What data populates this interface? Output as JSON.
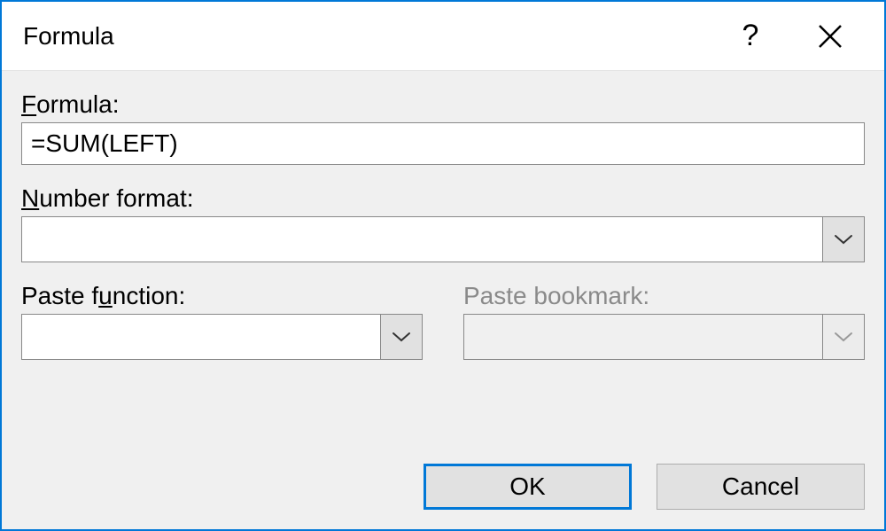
{
  "titlebar": {
    "title": "Formula",
    "help_tooltip": "?",
    "close_tooltip": "Close"
  },
  "fields": {
    "formula": {
      "label_pre": "",
      "label_accel": "F",
      "label_post": "ormula:",
      "value": "=SUM(LEFT)"
    },
    "number_format": {
      "label_pre": "",
      "label_accel": "N",
      "label_post": "umber format:",
      "value": ""
    },
    "paste_function": {
      "label_pre": "Paste f",
      "label_accel": "u",
      "label_post": "nction:",
      "value": ""
    },
    "paste_bookmark": {
      "label": "Paste bookmark:",
      "value": "",
      "disabled": true
    }
  },
  "buttons": {
    "ok": "OK",
    "cancel": "Cancel"
  }
}
